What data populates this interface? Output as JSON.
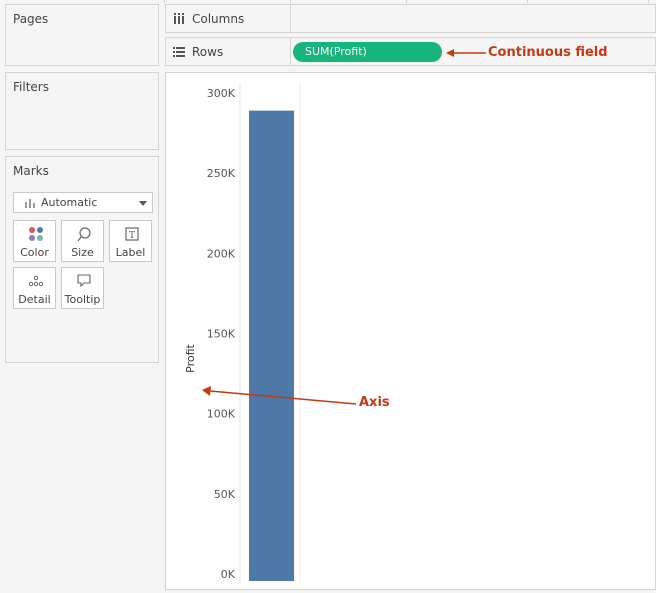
{
  "panels": {
    "pages": {
      "title": "Pages"
    },
    "filters": {
      "title": "Filters"
    },
    "marks": {
      "title": "Marks",
      "mark_type": "Automatic",
      "buttons": [
        {
          "label": "Color",
          "icon": "color-dots-icon"
        },
        {
          "label": "Size",
          "icon": "size-lasso-icon"
        },
        {
          "label": "Label",
          "icon": "label-text-icon"
        },
        {
          "label": "Detail",
          "icon": "detail-dots-icon"
        },
        {
          "label": "Tooltip",
          "icon": "tooltip-bubble-icon"
        }
      ]
    }
  },
  "shelves": {
    "columns": {
      "label": "Columns",
      "icon": "columns-icon"
    },
    "rows": {
      "label": "Rows",
      "icon": "rows-icon",
      "pill": "SUM(Profit)",
      "pill_color": "#17b57c"
    }
  },
  "annotations": {
    "continuous": "Continuous field",
    "axis": "Axis",
    "color": "#c33a12"
  },
  "chart_data": {
    "type": "bar",
    "categories": [
      ""
    ],
    "values": [
      289000
    ],
    "ylabel": "Profit",
    "ylim": [
      0,
      300000
    ],
    "yticks": [
      0,
      50000,
      100000,
      150000,
      200000,
      250000,
      300000
    ],
    "ytick_labels": [
      "0K",
      "50K",
      "100K",
      "150K",
      "200K",
      "250K",
      "300K"
    ],
    "bar_color": "#4e79a7",
    "grid": false
  }
}
